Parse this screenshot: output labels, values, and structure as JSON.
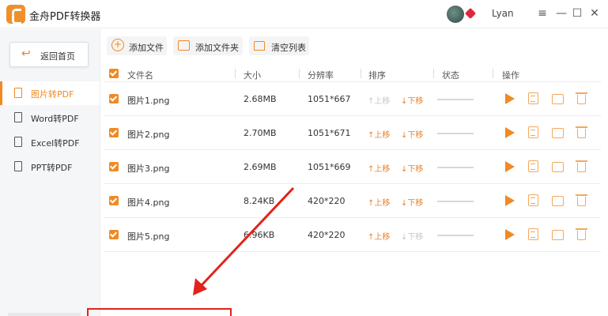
{
  "app": {
    "title": "金舟PDF转换器",
    "username": "Lyan",
    "window_controls": [
      "≡",
      "—",
      "☐",
      "✕"
    ]
  },
  "sidebar": {
    "home_label": "返回首页",
    "items": [
      {
        "label": "图片转PDF",
        "active": true
      },
      {
        "label": "Word转PDF",
        "active": false
      },
      {
        "label": "Excel转PDF",
        "active": false
      },
      {
        "label": "PPT转PDF",
        "active": false
      }
    ]
  },
  "toolbar": {
    "add_file": "添加文件",
    "add_folder": "添加文件夹",
    "clear_list": "清空列表"
  },
  "table": {
    "headers": {
      "name": "文件名",
      "size": "大小",
      "resolution": "分辨率",
      "sort": "排序",
      "status": "状态",
      "actions": "操作"
    },
    "move_up": "上移",
    "move_down": "下移",
    "rows": [
      {
        "name": "图片1.png",
        "size": "2.68MB",
        "resolution": "1051*667",
        "up_enabled": false,
        "down_enabled": true
      },
      {
        "name": "图片2.png",
        "size": "2.70MB",
        "resolution": "1051*671",
        "up_enabled": true,
        "down_enabled": true
      },
      {
        "name": "图片3.png",
        "size": "2.69MB",
        "resolution": "1051*669",
        "up_enabled": true,
        "down_enabled": true
      },
      {
        "name": "图片4.png",
        "size": "8.24KB",
        "resolution": "420*220",
        "up_enabled": true,
        "down_enabled": true
      },
      {
        "name": "图片5.png",
        "size": "6.96KB",
        "resolution": "420*220",
        "up_enabled": true,
        "down_enabled": false
      }
    ]
  },
  "colors": {
    "accent": "#f08a24",
    "annotation": "#e2231a"
  }
}
